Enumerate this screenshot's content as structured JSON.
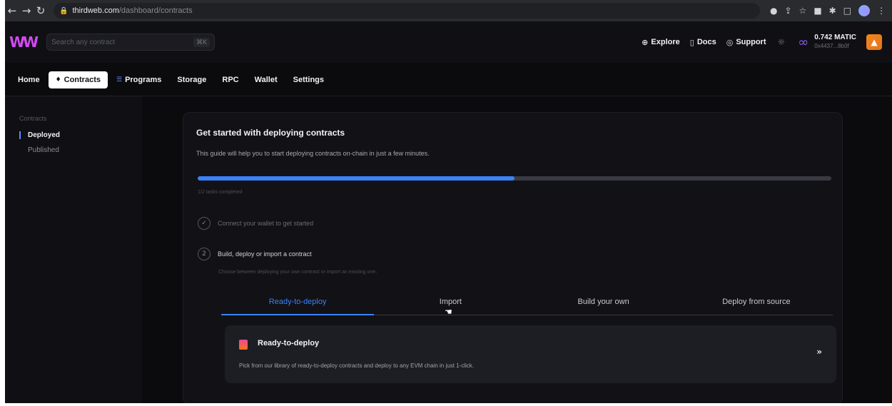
{
  "browser": {
    "url_host": "thirdweb.com",
    "url_path": "/dashboard/contracts"
  },
  "header": {
    "search_placeholder": "Search any contract",
    "search_shortcut": "⌘K",
    "links": [
      {
        "label": "Explore",
        "icon": "globe-icon"
      },
      {
        "label": "Docs",
        "icon": "document-icon"
      },
      {
        "label": "Support",
        "icon": "support-icon"
      }
    ],
    "balance": "0.742 MATIC",
    "address": "0x4437...8b0f"
  },
  "nav": {
    "items": [
      {
        "label": "Home"
      },
      {
        "label": "Contracts"
      },
      {
        "label": "Programs"
      },
      {
        "label": "Storage"
      },
      {
        "label": "RPC"
      },
      {
        "label": "Wallet"
      },
      {
        "label": "Settings"
      }
    ],
    "active": "Contracts"
  },
  "sidebar": {
    "title": "Contracts",
    "items": [
      {
        "label": "Deployed",
        "active": true
      },
      {
        "label": "Published",
        "active": false
      }
    ]
  },
  "guide": {
    "title": "Get started with deploying contracts",
    "subtitle": "This guide will help you to start deploying contracts on-chain in just a few minutes.",
    "progress_fraction": 0.5,
    "progress_label": "1/2 tasks completed",
    "steps": [
      {
        "number": "✓",
        "text": "Connect your wallet to get started"
      },
      {
        "number": "2",
        "text": "Build, deploy or import a contract",
        "subtitle": "Choose between deploying your own contract or import an existing one."
      }
    ],
    "tabs": [
      {
        "label": "Ready-to-deploy",
        "active": true
      },
      {
        "label": "Import",
        "active": false
      },
      {
        "label": "Build your own",
        "active": false
      },
      {
        "label": "Deploy from source",
        "active": false
      }
    ],
    "option": {
      "title": "Ready-to-deploy",
      "description": "Pick from our library of ready-to-deploy contracts and deploy to any EVM chain in just 1-click."
    }
  },
  "colors": {
    "accent": "#3b82f6",
    "background": "#0b0b0e"
  }
}
